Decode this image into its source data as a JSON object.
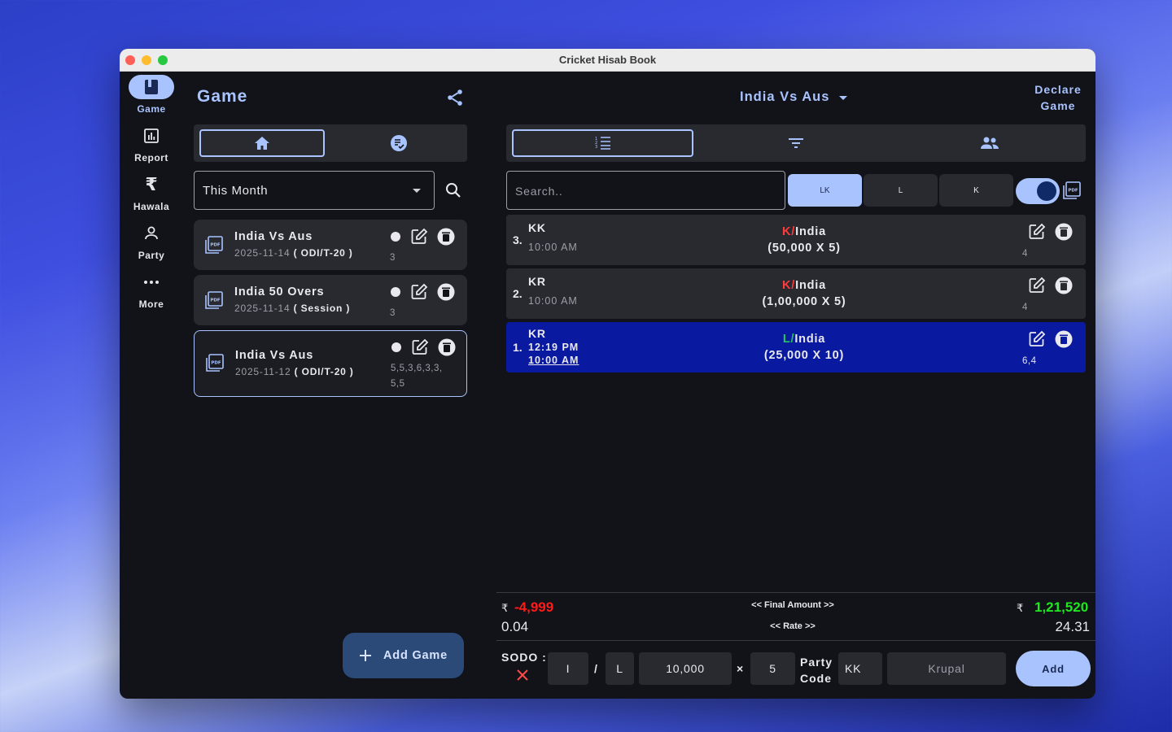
{
  "window": {
    "title": "Cricket Hisab Book"
  },
  "rail": {
    "items": [
      {
        "label": "Game",
        "icon": "book-icon",
        "active": true
      },
      {
        "label": "Report",
        "icon": "chart-icon",
        "active": false
      },
      {
        "label": "Hawala",
        "icon": "rupee-icon",
        "active": false
      },
      {
        "label": "Party",
        "icon": "person-icon",
        "active": false
      },
      {
        "label": "More",
        "icon": "more-icon",
        "active": false
      }
    ]
  },
  "left": {
    "title": "Game",
    "period": "This Month",
    "add_game_label": "Add Game",
    "games": [
      {
        "title": "India Vs Aus",
        "date": "2025-11-14",
        "type": "( ODI/T-20 )",
        "nums_line1": "3",
        "nums_line2": ""
      },
      {
        "title": "India 50 Overs",
        "date": "2025-11-14",
        "type": "( Session )",
        "nums_line1": "3",
        "nums_line2": ""
      },
      {
        "title": "India Vs Aus",
        "date": "2025-11-12",
        "type": "( ODI/T-20 )",
        "nums_line1": "5,5,3,6,3,3,",
        "nums_line2": "5,5"
      }
    ]
  },
  "right": {
    "match": "India Vs Aus",
    "declare_line1": "Declare",
    "declare_line2": "Game",
    "search_placeholder": "Search..",
    "chips": [
      "LK",
      "L",
      "K"
    ],
    "entries": [
      {
        "idx": "3.",
        "code": "KK",
        "time1": "10:00 AM",
        "time2": "",
        "side": "K",
        "slash": "/",
        "team": "India",
        "amount": "(50,000 X 5)",
        "n": "4"
      },
      {
        "idx": "2.",
        "code": "KR",
        "time1": "10:00 AM",
        "time2": "",
        "side": "K",
        "slash": "/",
        "team": "India",
        "amount": "(1,00,000 X 5)",
        "n": "4"
      },
      {
        "idx": "1.",
        "code": "KR",
        "time1": "12:19 PM",
        "time2": "10:00 AM",
        "side": "L",
        "slash": "/",
        "team": "India",
        "amount": "(25,000 X 10)",
        "n": "6,4"
      }
    ],
    "summary": {
      "currency": "₹",
      "negative": "-4,999",
      "positive": "1,21,520",
      "final_label": "<< Final Amount >>",
      "rate_label": "<< Rate >>",
      "rate_left": "0.04",
      "rate_right": "24.31"
    },
    "form": {
      "sodo_label": "SODO :",
      "field1": "I",
      "slash": "/",
      "field2": "L",
      "amount": "10,000",
      "times": "×",
      "rate": "5",
      "party_label_1": "Party",
      "party_label_2": "Code",
      "party_code": "KK",
      "party_name_placeholder": "Krupal",
      "add_label": "Add"
    }
  },
  "colors": {
    "accent": "#a9c3ff",
    "selected_row": "#0a1aa0",
    "negative": "#ff1a1a",
    "positive": "#1ee81e",
    "k_side": "#ff3b3b",
    "l_side": "#22c55e"
  }
}
